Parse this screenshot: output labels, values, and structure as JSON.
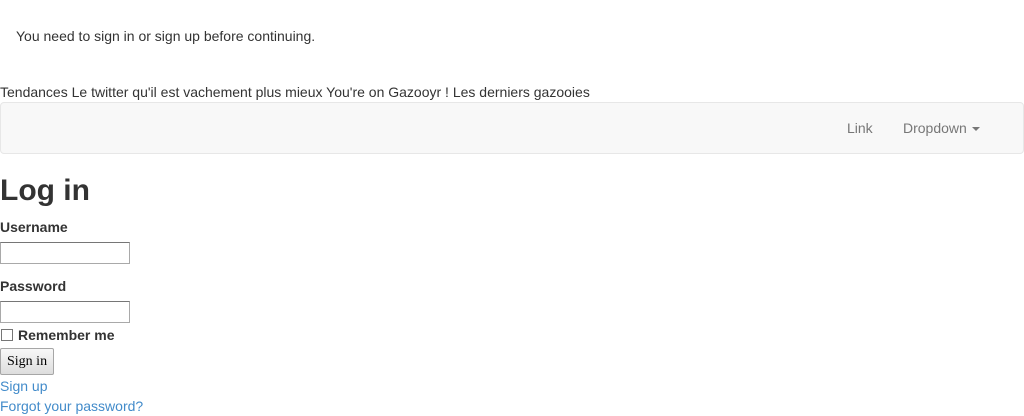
{
  "alert": {
    "message": "You need to sign in or sign up before continuing."
  },
  "header": {
    "items": [
      "Tendances",
      "Le twitter qu'il est vachement plus mieux",
      "You're on Gazooyr !",
      "Les derniers gazooies"
    ]
  },
  "navbar": {
    "link_label": "Link",
    "dropdown_label": "Dropdown"
  },
  "login": {
    "title": "Log in",
    "username_label": "Username",
    "username_value": "",
    "password_label": "Password",
    "password_value": "",
    "remember_label": "Remember me",
    "remember_checked": false,
    "submit_label": "Sign in",
    "signup_link": "Sign up",
    "forgot_link": "Forgot your password?"
  },
  "colors": {
    "link": "#428bca",
    "navbar_bg": "#f8f8f8",
    "navbar_border": "#e7e7e7",
    "nav_text": "#777777",
    "text": "#333333"
  }
}
